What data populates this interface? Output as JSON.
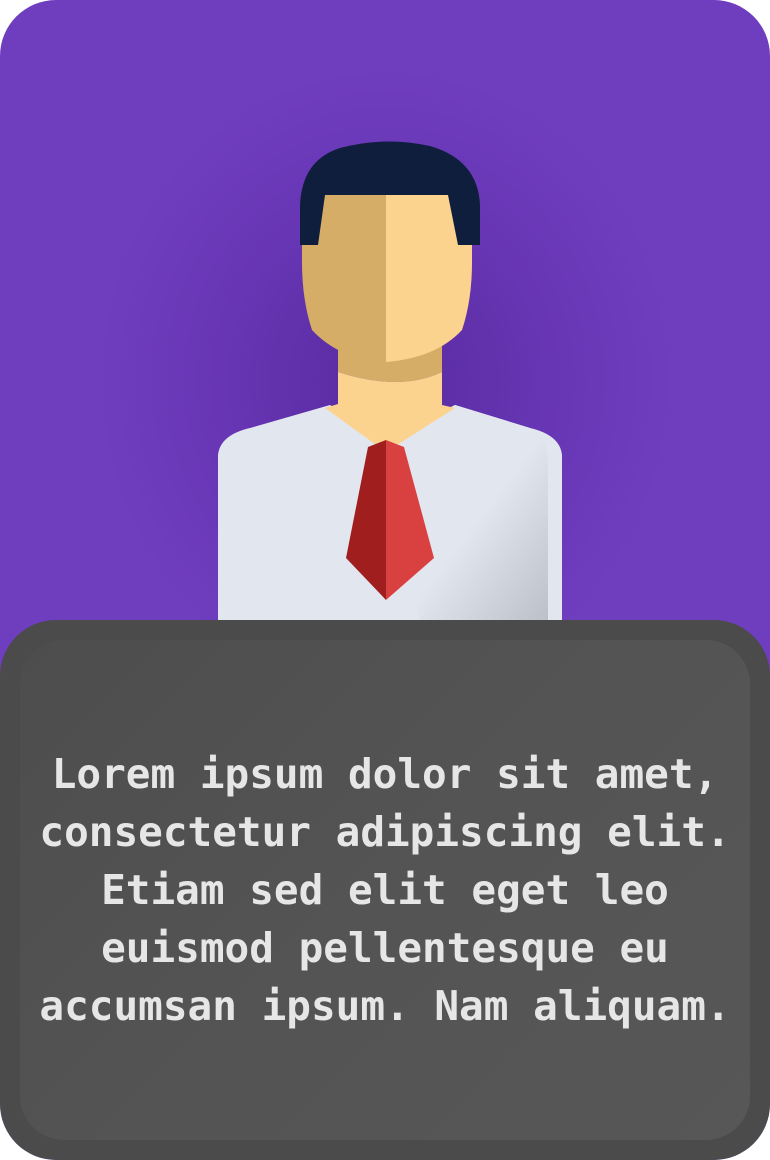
{
  "card": {
    "background_color": "#6f3ebf",
    "panel_color": "#4b4b4b",
    "text_color": "#e6e6e6"
  },
  "avatar": {
    "icon": "businessman-avatar-icon",
    "colors": {
      "hair": "#0f1e3d",
      "skin_light": "#fbd38e",
      "skin_shadow": "#d5ad66",
      "shirt": "#e2e6ef",
      "shirt_shadow": "#c2c6cf",
      "tie_light": "#d94141",
      "tie_dark": "#a01e1e"
    }
  },
  "description": {
    "text": "Lorem ipsum dolor sit amet, consectetur adipiscing elit. Etiam sed elit eget leo euismod pellentesque eu accumsan ipsum. Nam aliquam."
  }
}
